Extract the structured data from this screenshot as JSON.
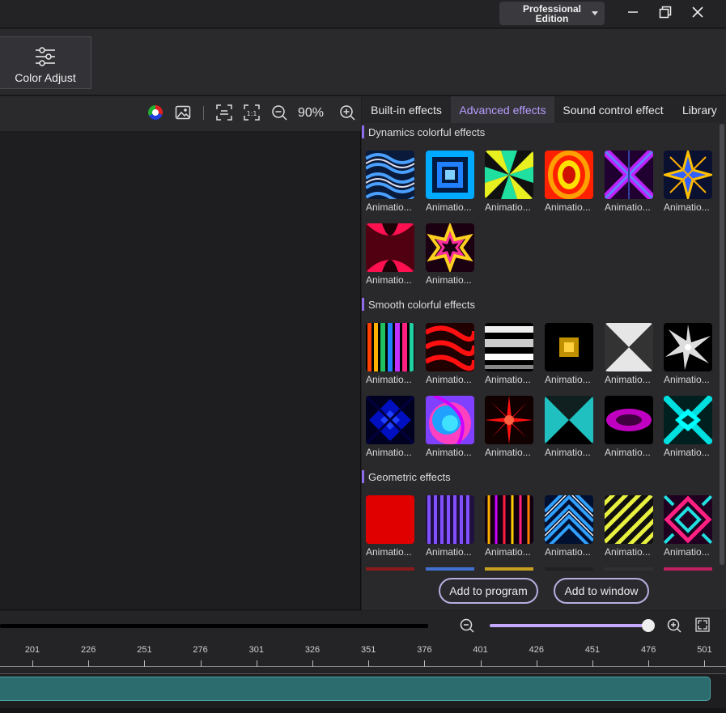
{
  "titlebar": {
    "edition_label": "Professional\nEdition",
    "edition_line1": "Professional",
    "edition_line2": "Edition",
    "minimize_icon": "minimize-icon",
    "restore_icon": "restore-icon",
    "close_icon": "close-icon"
  },
  "toolbar": {
    "color_adjust_label": "Color Adjust"
  },
  "preview": {
    "zoom_label": "90%"
  },
  "tabs": [
    {
      "label": "Built-in effects",
      "active": false
    },
    {
      "label": "Advanced effects",
      "active": true
    },
    {
      "label": "Sound control effect",
      "active": false
    },
    {
      "label": "Library",
      "active": false
    }
  ],
  "sections": [
    {
      "title": "Dynamics colorful effects"
    },
    {
      "title": "Smooth colorful effects"
    },
    {
      "title": "Geometric effects"
    }
  ],
  "effect_label": "Animatio...",
  "effects": {
    "dynamics": [
      "wavy-blue",
      "square-tunnel-blue",
      "green-yellow-rays",
      "yellow-red-rings",
      "purple-x",
      "blue-yellow-star",
      "pink-x",
      "yellow-pink-star"
    ],
    "smooth": [
      "rainbow-stripes",
      "red-waves",
      "white-bars",
      "yellow-square",
      "white-x",
      "white-star",
      "blue-diamond",
      "rainbow-swirl",
      "red-burst",
      "cyan-x",
      "magenta-ellipse",
      "cyan-diamond"
    ],
    "geometric": [
      "red-solid",
      "purple-stripes",
      "colored-stripes",
      "blue-chevron",
      "yellow-diagonal",
      "pink-cyan-diamond"
    ]
  },
  "actions": {
    "add_to_program": "Add to program",
    "add_to_window": "Add to window"
  },
  "timeline": {
    "zoom_level": 0.98,
    "ticks": [
      "201",
      "226",
      "251",
      "276",
      "301",
      "326",
      "351",
      "376",
      "401",
      "426",
      "451",
      "476",
      "501"
    ]
  },
  "colors": {
    "accent": "#b89cff",
    "section_bar": "#8e6be8",
    "track": "#2c6b6e"
  }
}
